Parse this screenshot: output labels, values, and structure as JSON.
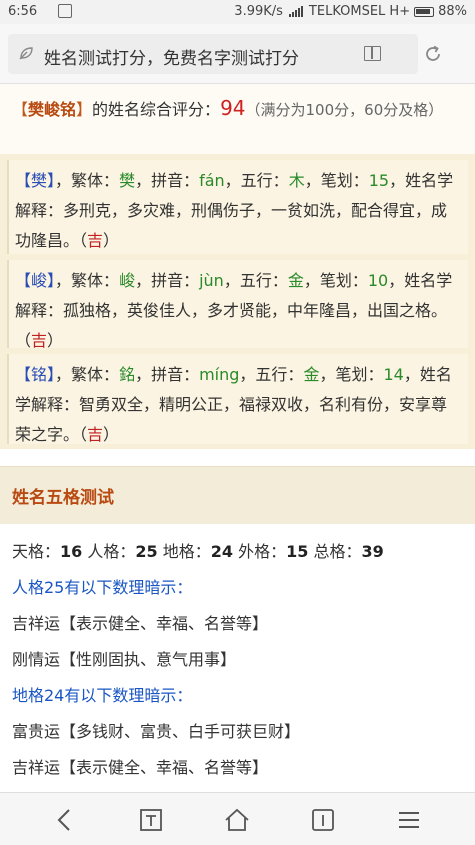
{
  "status_bar": {
    "time": "6:56",
    "speed": "3.99K/s",
    "carrier": "TELKOMSEL H+",
    "battery": "88%"
  },
  "browser": {
    "page_title": "姓名测试打分，免费名字测试打分",
    "icons": [
      "leaf-icon",
      "reader-mode-icon",
      "refresh-icon"
    ]
  },
  "summary": {
    "name": "樊峻铭",
    "suffix": "的姓名综合评分：",
    "score": "94",
    "note": "（满分为100分，60分及格）"
  },
  "characters": [
    {
      "char": "樊",
      "traditional_label": "，繁体：",
      "traditional": "樊",
      "pinyin_label": "，拼音：",
      "pinyin": "fán",
      "element_label": "，五行：",
      "element": "木",
      "strokes_label": "，笔划：",
      "strokes": "15",
      "explain_label": "，姓名学解释：",
      "explain": "多刑克，多灾难，刑偶伤子，一贫如洗，配合得宜，成功隆昌。",
      "verdict": "吉"
    },
    {
      "char": "峻",
      "traditional_label": "，繁体：",
      "traditional": "峻",
      "pinyin_label": "，拼音：",
      "pinyin": "jùn",
      "element_label": "，五行：",
      "element": "金",
      "strokes_label": "，笔划：",
      "strokes": "10",
      "explain_label": "，姓名学解释：",
      "explain": "孤独格，英俊佳人，多才贤能，中年隆昌，出国之格。",
      "verdict": "吉"
    },
    {
      "char": "铭",
      "traditional_label": "，繁体：",
      "traditional": "銘",
      "pinyin_label": "，拼音：",
      "pinyin": "míng",
      "element_label": "，五行：",
      "element": "金",
      "strokes_label": "，笔划：",
      "strokes": "14",
      "explain_label": "，姓名学解释：",
      "explain": "智勇双全，精明公正，福禄双收，名利有份，安享尊荣之字。",
      "verdict": "吉"
    }
  ],
  "wuge": {
    "heading": "姓名五格测试",
    "tian_label": "天格：",
    "tian": "16",
    "ren_label": "人格：",
    "ren": "25",
    "di_label": "地格：",
    "di": "24",
    "wai_label": "外格：",
    "wai": "15",
    "zong_label": "总格：",
    "zong": "39",
    "ren_hint": "人格25有以下数理暗示：",
    "ren_lines": [
      "吉祥运【表示健全、幸福、名誉等】",
      "刚情运【性刚固执、意气用事】"
    ],
    "di_hint": "地格24有以下数理暗示：",
    "di_lines": [
      "富贵运【多钱财、富贵、白手可获巨财】",
      "吉祥运【表示健全、幸福、名誉等】"
    ]
  },
  "nav": [
    "back-icon",
    "tab-text-icon",
    "home-icon",
    "tabs-count-icon",
    "menu-icon"
  ]
}
